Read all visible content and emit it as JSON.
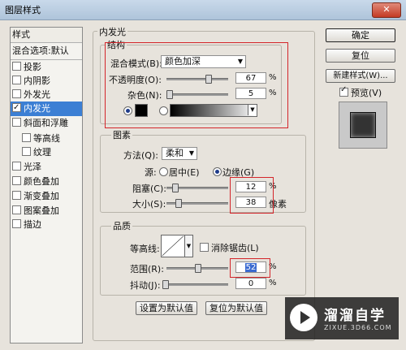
{
  "window": {
    "title": "图层样式",
    "close_label": "✕"
  },
  "sidebar": {
    "header": "样式",
    "items": [
      {
        "label": "混合选项:默认",
        "checkbox": false,
        "checked": false
      },
      {
        "label": "投影",
        "checkbox": true,
        "checked": false
      },
      {
        "label": "内阴影",
        "checkbox": true,
        "checked": false
      },
      {
        "label": "外发光",
        "checkbox": true,
        "checked": false
      },
      {
        "label": "内发光",
        "checkbox": true,
        "checked": true,
        "selected": true
      },
      {
        "label": "斜面和浮雕",
        "checkbox": true,
        "checked": false
      },
      {
        "label": "等高线",
        "checkbox": true,
        "checked": false,
        "indent": true
      },
      {
        "label": "纹理",
        "checkbox": true,
        "checked": false,
        "indent": true
      },
      {
        "label": "光泽",
        "checkbox": true,
        "checked": false
      },
      {
        "label": "颜色叠加",
        "checkbox": true,
        "checked": false
      },
      {
        "label": "渐变叠加",
        "checkbox": true,
        "checked": false
      },
      {
        "label": "图案叠加",
        "checkbox": true,
        "checked": false
      },
      {
        "label": "描边",
        "checkbox": true,
        "checked": false
      }
    ]
  },
  "main": {
    "section_title": "内发光",
    "structure": {
      "title": "结构",
      "blend_mode_label": "混合模式(B):",
      "blend_mode_value": "颜色加深",
      "opacity_label": "不透明度(O):",
      "opacity_value": "67",
      "noise_label": "杂色(N):",
      "noise_value": "5",
      "percent": "%"
    },
    "elements": {
      "title": "图素",
      "method_label": "方法(Q):",
      "method_value": "柔和",
      "source_label": "源:",
      "source_center": "居中(E)",
      "source_edge": "边缘(G)",
      "choke_label": "阻塞(C):",
      "choke_value": "12",
      "size_label": "大小(S):",
      "size_value": "38",
      "size_unit": "像素",
      "percent": "%"
    },
    "quality": {
      "title": "品质",
      "contour_label": "等高线:",
      "antialias_label": "消除锯齿(L)",
      "range_label": "范围(R):",
      "range_value": "52",
      "jitter_label": "抖动(J):",
      "jitter_value": "0",
      "percent": "%"
    },
    "make_default": "设置为默认值",
    "reset_default": "复位为默认值"
  },
  "right": {
    "ok": "确定",
    "reset": "复位",
    "new_style": "新建样式(W)...",
    "preview_label": "预览(V)",
    "preview_checked": true
  },
  "watermark": {
    "brand": "溜溜自学",
    "url": "ZIXUE.3D66.COM"
  }
}
